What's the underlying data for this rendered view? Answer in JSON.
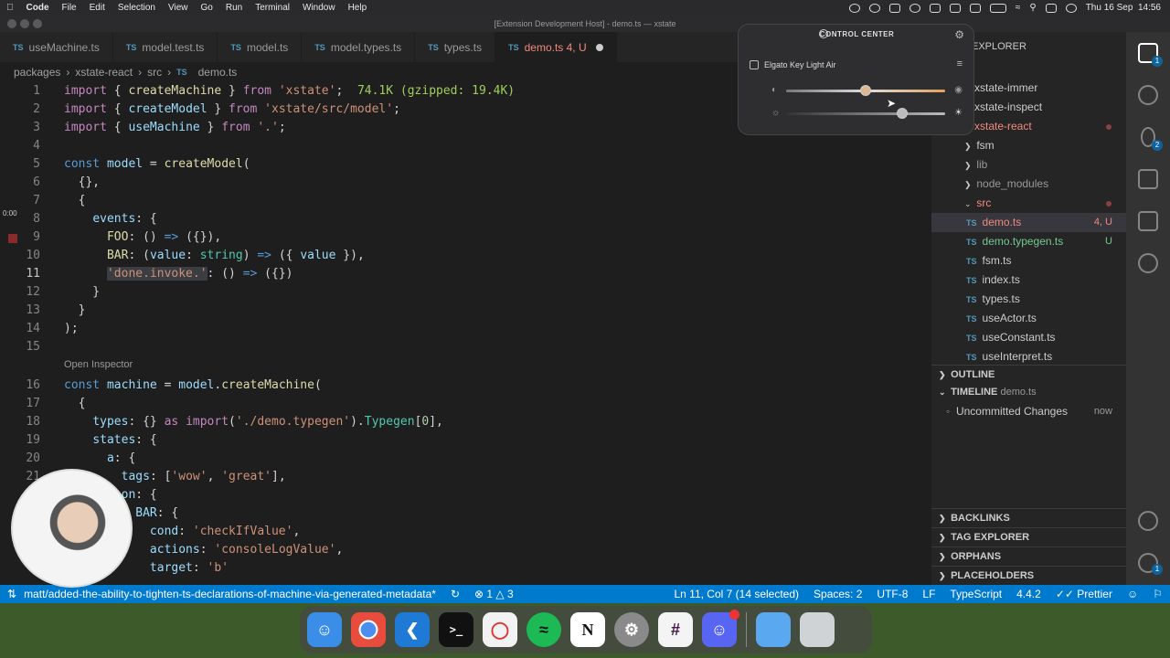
{
  "menubar": {
    "app": "Code",
    "items": [
      "File",
      "Edit",
      "Selection",
      "View",
      "Go",
      "Run",
      "Terminal",
      "Window",
      "Help"
    ],
    "datetime": "Thu 16 Sep  14:56"
  },
  "window_title": "[Extension Development Host] - demo.ts — xstate",
  "tabs": [
    {
      "label": "useMachine.ts",
      "active": false
    },
    {
      "label": "model.test.ts",
      "active": false
    },
    {
      "label": "model.ts",
      "active": false
    },
    {
      "label": "model.types.ts",
      "active": false
    },
    {
      "label": "types.ts",
      "active": false
    },
    {
      "label": "demo.ts",
      "suffix": "4, U",
      "active": true
    }
  ],
  "breadcrumb": [
    "packages",
    "xstate-react",
    "src",
    "demo.ts"
  ],
  "editor": {
    "codelens": "Open Inspector",
    "gutter_time": "0:00",
    "line_numbers": [
      "1",
      "2",
      "3",
      "4",
      "5",
      "6",
      "7",
      "8",
      "9",
      "10",
      "11",
      "12",
      "13",
      "14",
      "15",
      "16",
      "17",
      "18",
      "19",
      "20",
      "21"
    ],
    "import_cost": "74.1K (gzipped: 19.4K)"
  },
  "sidebar": {
    "header": "EXPLORER",
    "items": [
      {
        "label": "xstate-immer"
      },
      {
        "label": "xstate-inspect"
      },
      {
        "label": "xstate-react",
        "modified": true
      },
      {
        "label": "fsm"
      },
      {
        "label": "lib"
      },
      {
        "label": "node_modules"
      },
      {
        "label": "src"
      },
      {
        "label": "demo.ts",
        "badge": "4, U"
      },
      {
        "label": "demo.typegen.ts",
        "badge": "U"
      },
      {
        "label": "fsm.ts"
      },
      {
        "label": "index.ts"
      },
      {
        "label": "types.ts"
      },
      {
        "label": "useActor.ts"
      },
      {
        "label": "useConstant.ts"
      },
      {
        "label": "useInterpret.ts"
      }
    ],
    "outline": "OUTLINE",
    "timeline": "TIMELINE",
    "timeline_file": "demo.ts",
    "timeline_entry": "Uncommitted Changes",
    "timeline_time": "now",
    "backlinks": "BACKLINKS",
    "tag_explorer": "TAG EXPLORER",
    "orphans": "ORPHANS",
    "placeholders": "PLACEHOLDERS"
  },
  "statusbar": {
    "branch": "matt/added-the-ability-to-tighten-ts-declarations-of-machine-via-generated-metadata*",
    "errors": "1",
    "warnings": "3",
    "position": "Ln 11, Col 7 (14 selected)",
    "spaces": "Spaces: 2",
    "encoding": "UTF-8",
    "eol": "LF",
    "language": "TypeScript",
    "version": "4.4.2",
    "formatter": "Prettier"
  },
  "control_center": {
    "title": "CONTROL CENTER",
    "device": "Elgato Key Light Air",
    "brightness": 0.5,
    "temperature": 0.73
  },
  "dock": [
    "finder",
    "chrome",
    "vscode",
    "terminal",
    "app",
    "spotify",
    "notion",
    "settings",
    "slack",
    "discord",
    "folder",
    "trash"
  ],
  "colors": {
    "statusbar": "#007acc",
    "editor_bg": "#1e1e1e",
    "sidebar_bg": "#252526",
    "active_tab_text": "#f1897f"
  }
}
